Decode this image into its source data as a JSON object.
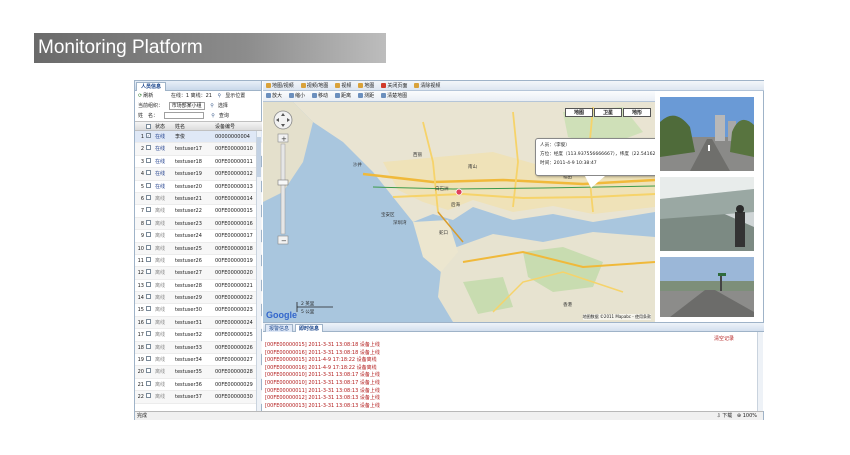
{
  "banner": {
    "title": "Monitoring Platform"
  },
  "left_panel": {
    "tab": "人员信息",
    "refresh": "刷新",
    "online_stats": "在线：1  离线：21",
    "show_position": "显示位置",
    "group_label": "当前组织：",
    "group_value": "市场部某小组",
    "select": "选择",
    "name_label": "姓　名：",
    "query": "查询",
    "columns": {
      "status": "状态",
      "name": "姓名",
      "device": "设备编号"
    },
    "rows": [
      {
        "no": "1",
        "status": "在线",
        "name": "李俊",
        "device": "00000000004",
        "checked": true,
        "online": true
      },
      {
        "no": "2",
        "status": "在线",
        "name": "testuser17",
        "device": "00FE00000010",
        "checked": false,
        "online": true
      },
      {
        "no": "3",
        "status": "在线",
        "name": "testuser18",
        "device": "00FE00000011",
        "checked": false,
        "online": true
      },
      {
        "no": "4",
        "status": "在线",
        "name": "testuser19",
        "device": "00FE00000012",
        "checked": false,
        "online": true
      },
      {
        "no": "5",
        "status": "在线",
        "name": "testuser20",
        "device": "00FE00000013",
        "checked": false,
        "online": true
      },
      {
        "no": "6",
        "status": "离线",
        "name": "testuser21",
        "device": "00FE00000014",
        "checked": false,
        "online": false
      },
      {
        "no": "7",
        "status": "离线",
        "name": "testuser22",
        "device": "00FE00000015",
        "checked": false,
        "online": false
      },
      {
        "no": "8",
        "status": "离线",
        "name": "testuser23",
        "device": "00FE00000016",
        "checked": false,
        "online": false
      },
      {
        "no": "9",
        "status": "离线",
        "name": "testuser24",
        "device": "00FE00000017",
        "checked": false,
        "online": false
      },
      {
        "no": "10",
        "status": "离线",
        "name": "testuser25",
        "device": "00FE00000018",
        "checked": false,
        "online": false
      },
      {
        "no": "11",
        "status": "离线",
        "name": "testuser26",
        "device": "00FE00000019",
        "checked": false,
        "online": false
      },
      {
        "no": "12",
        "status": "离线",
        "name": "testuser27",
        "device": "00FE00000020",
        "checked": false,
        "online": false
      },
      {
        "no": "13",
        "status": "离线",
        "name": "testuser28",
        "device": "00FE00000021",
        "checked": false,
        "online": false
      },
      {
        "no": "14",
        "status": "离线",
        "name": "testuser29",
        "device": "00FE00000022",
        "checked": false,
        "online": false
      },
      {
        "no": "15",
        "status": "离线",
        "name": "testuser30",
        "device": "00FE00000023",
        "checked": false,
        "online": false
      },
      {
        "no": "16",
        "status": "离线",
        "name": "testuser31",
        "device": "00FE00000024",
        "checked": false,
        "online": false
      },
      {
        "no": "17",
        "status": "离线",
        "name": "testuser32",
        "device": "00FE00000025",
        "checked": false,
        "online": false
      },
      {
        "no": "18",
        "status": "离线",
        "name": "testuser33",
        "device": "00FE00000026",
        "checked": false,
        "online": false
      },
      {
        "no": "19",
        "status": "离线",
        "name": "testuser34",
        "device": "00FE00000027",
        "checked": false,
        "online": false
      },
      {
        "no": "20",
        "status": "离线",
        "name": "testuser35",
        "device": "00FE00000028",
        "checked": false,
        "online": false
      },
      {
        "no": "21",
        "status": "离线",
        "name": "testuser36",
        "device": "00FE00000029",
        "checked": false,
        "online": false
      },
      {
        "no": "22",
        "status": "离线",
        "name": "testuser37",
        "device": "00FE00000030",
        "checked": false,
        "online": false
      }
    ]
  },
  "toolbar1": {
    "items": [
      "地图/视频",
      "视频/地图",
      "视频",
      "地图",
      "关闭页面",
      "清除视频"
    ]
  },
  "toolbar2": {
    "items": [
      "放大",
      "缩小",
      "移动",
      "距离",
      "测距",
      "清楚地图"
    ]
  },
  "map": {
    "types": [
      "地图",
      "卫星",
      "地形"
    ],
    "popup": {
      "line1": "人员：（李俊）",
      "line2": "方位：经度（113.937556666667），纬度（22.541625）",
      "line3": "时间：2011-4-9 10:38:47",
      "close": "×"
    },
    "scale": [
      "2 英里",
      "5 公里"
    ],
    "logo": "Google",
    "copyright": "地图数据 ©2011 Mapabc - 使用条款",
    "places": [
      "西丽",
      "白石洲",
      "蛇口",
      "南山",
      "宝安区",
      "深圳湾",
      "香港",
      "后海",
      "沙井",
      "福田"
    ]
  },
  "bottom": {
    "tabs": [
      "报警信息",
      "即时信息"
    ],
    "clear": "清空记录",
    "log": [
      "[00FE00000015] 2011-3-31 13:08:18 设备上线",
      "[00FE00000016] 2011-3-31 13:08:18 设备上线",
      "[00FE00000015] 2011-4-9 17:18:22 设备离线",
      "[00FE00000016] 2011-4-9 17:18:22 设备离线",
      "[00FE00000010] 2011-3-31 13:08:17 设备上线",
      "[00FE00000010] 2011-3-31 13:08:17 设备上线",
      "[00FE00000011] 2011-3-31 13:08:13 设备上线",
      "[00FE00000012] 2011-3-31 13:08:13 设备上线",
      "[00FE00000013] 2011-3-31 13:08:13 设备上线"
    ]
  },
  "status": {
    "left": "完成",
    "download": "下载",
    "zoom": "100%"
  }
}
